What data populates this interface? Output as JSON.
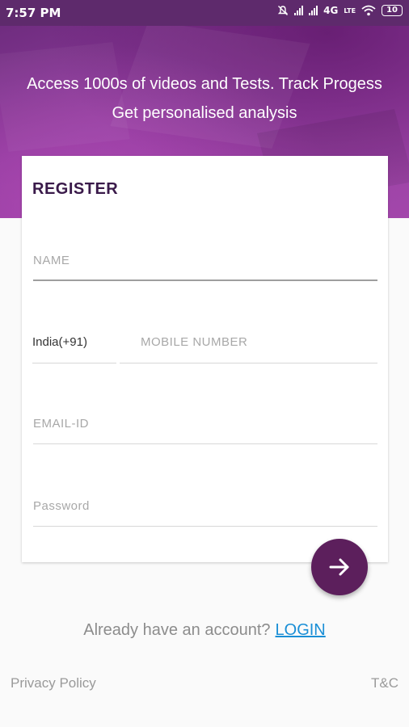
{
  "status_bar": {
    "time": "7:57 PM",
    "network": "4G",
    "volte": "LTE",
    "battery": "10",
    "icons": [
      "mute-icon",
      "signal-icon",
      "signal-icon",
      "wifi-icon",
      "battery-icon"
    ]
  },
  "hero": {
    "line1": "Access 1000s of videos and Tests. Track Progess",
    "line2": "Get personalised analysis"
  },
  "form": {
    "title": "REGISTER",
    "name_placeholder": "NAME",
    "country_code": "India(+91)",
    "mobile_placeholder": "MOBILE NUMBER",
    "email_placeholder": "EMAIL-ID",
    "password_placeholder": "Password"
  },
  "submit": {
    "icon": "arrow-right-icon"
  },
  "account_prompt": {
    "text": "Already have an account?",
    "login_label": "LOGIN"
  },
  "footer": {
    "privacy": "Privacy Policy",
    "terms": "T&C"
  },
  "colors": {
    "accent": "#5c1f5c",
    "link": "#1a8fd6",
    "hero_gradient": [
      "#6a2a7a",
      "#a347ab"
    ]
  }
}
